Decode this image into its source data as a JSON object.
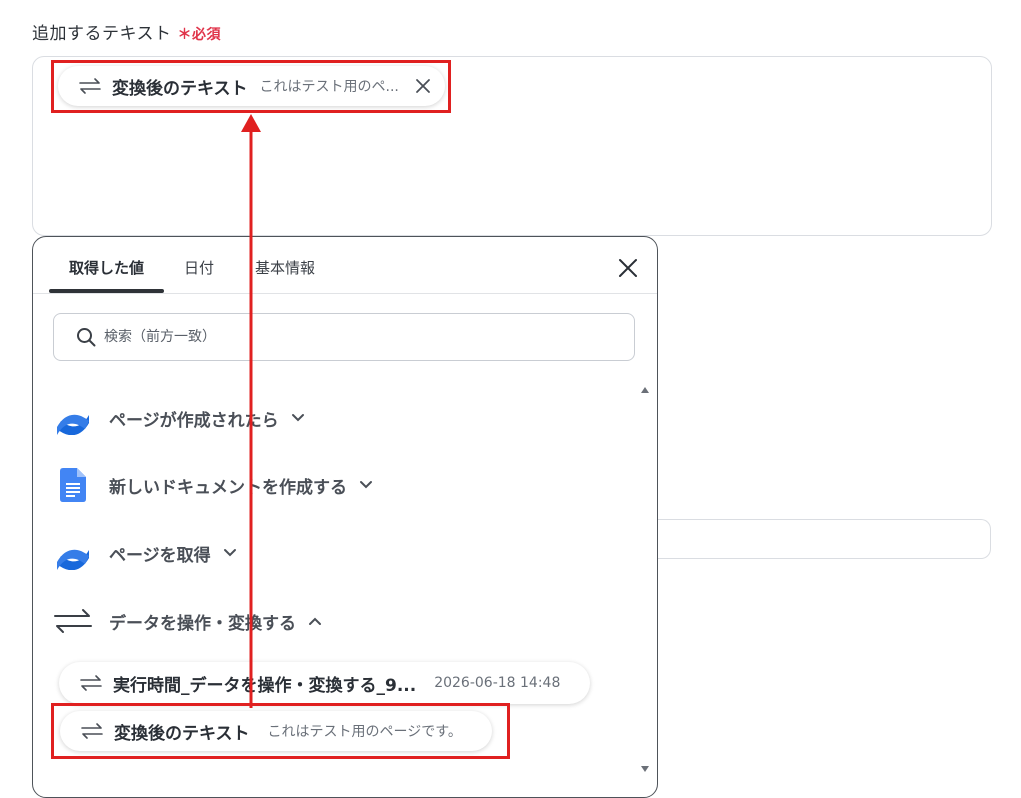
{
  "field": {
    "label": "追加するテキスト",
    "required_mark": "＊必須"
  },
  "selected_chip": {
    "name": "変換後のテキスト",
    "value": "これはテスト用のペ..."
  },
  "popup": {
    "tabs": [
      {
        "label": "取得した値",
        "active": true
      },
      {
        "label": "日付",
        "active": false
      },
      {
        "label": "基本情報",
        "active": false
      }
    ],
    "search": {
      "placeholder": "検索（前方一致）",
      "value": ""
    },
    "groups": [
      {
        "label": "ページが作成されたら",
        "icon": "confluence-icon",
        "expanded": false
      },
      {
        "label": "新しいドキュメントを作成する",
        "icon": "google-docs-icon",
        "expanded": false
      },
      {
        "label": "ページを取得",
        "icon": "confluence-icon",
        "expanded": false
      },
      {
        "label": "データを操作・変換する",
        "icon": "transform-arrows-icon",
        "expanded": true
      }
    ],
    "items": [
      {
        "name": "実行時間_データを操作・変換する_9...",
        "value": "2026-06-18 14:48"
      },
      {
        "name": "変換後のテキスト",
        "value": "これはテスト用のページです。"
      }
    ]
  },
  "colors": {
    "highlight": "#e02020",
    "required": "#e0344a",
    "confluence": "#1868db",
    "google_docs": "#4285f4"
  }
}
